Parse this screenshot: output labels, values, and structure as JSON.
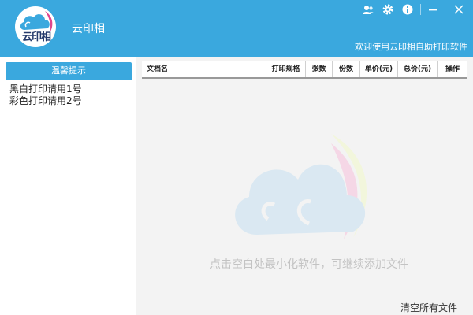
{
  "app": {
    "title": "云印相",
    "logo_text": "云印相",
    "welcome": "欢迎使用云印相自助打印软件",
    "brand_color": "#3aa8de"
  },
  "window_controls": [
    {
      "icon": "user-icon"
    },
    {
      "icon": "gear-icon"
    },
    {
      "icon": "info-icon"
    },
    {
      "icon": "minimize-icon"
    },
    {
      "icon": "close-icon"
    }
  ],
  "sidebar": {
    "header": "温馨提示",
    "tips": [
      "黑白打印请用1号",
      "彩色打印请用2号"
    ]
  },
  "table": {
    "columns": [
      "文档名",
      "打印规格",
      "张数",
      "份数",
      "单价(元)",
      "总价(元)",
      "操作"
    ],
    "rows": []
  },
  "main": {
    "hint": "点击空白处最小化软件，可继续添加文件",
    "clear_all": "清空所有文件"
  }
}
